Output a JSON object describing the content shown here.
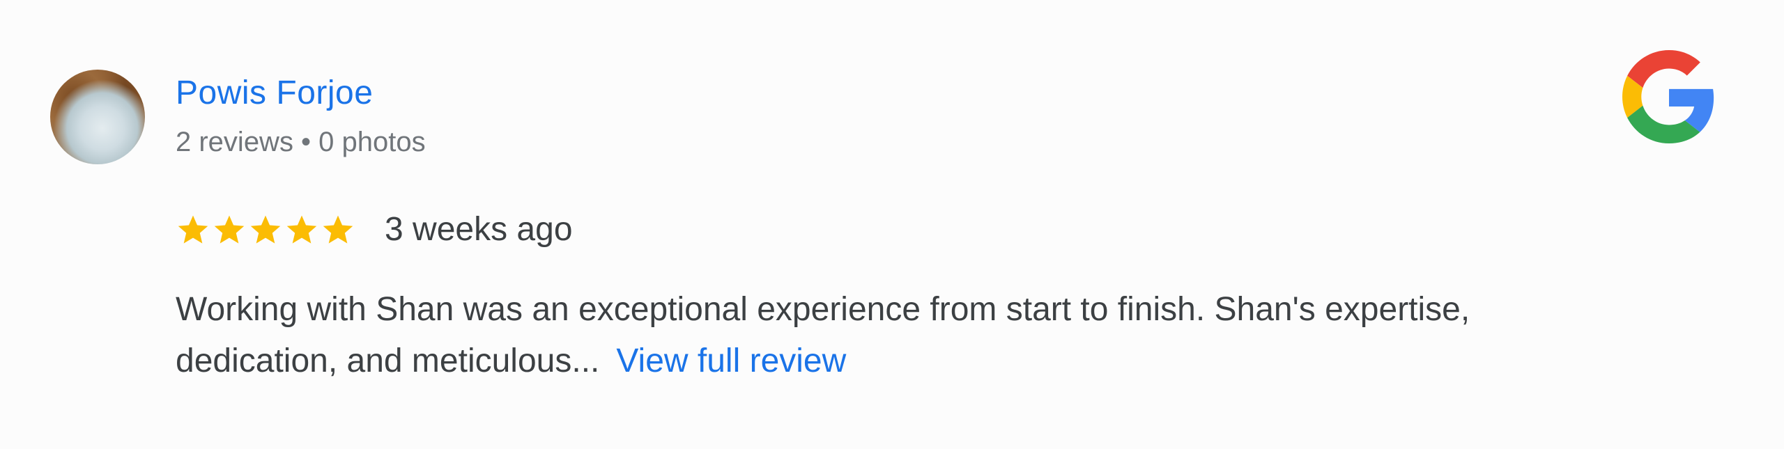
{
  "review": {
    "reviewer_name": "Powis Forjoe",
    "reviewer_meta": "2 reviews • 0 photos",
    "rating": 5,
    "rating_max": 5,
    "time": "3 weeks ago",
    "text_excerpt": "Working with Shan was an exceptional experience from start to finish. Shan's expertise, dedication, and meticulous...",
    "view_full_label": "View full review"
  },
  "icons": {
    "avatar": "reviewer-avatar",
    "star": "star-icon",
    "brand": "google-logo"
  },
  "colors": {
    "link": "#1a73e8",
    "star": "#fbbc04",
    "meta": "#70757a",
    "text": "#3c4043",
    "google_blue": "#4285f4",
    "google_red": "#ea4335",
    "google_yellow": "#fbbc05",
    "google_green": "#34a853"
  }
}
